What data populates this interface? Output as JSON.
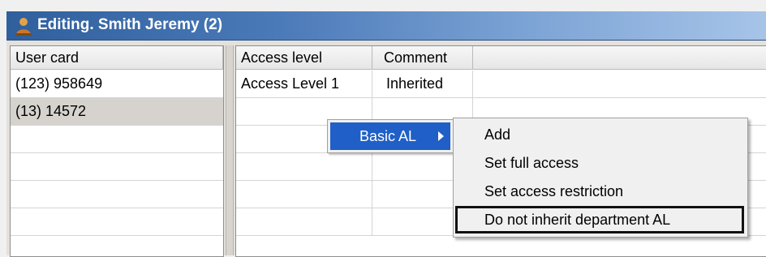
{
  "window": {
    "title": "Editing. Smith Jeremy (2)",
    "title_icon": "user-icon"
  },
  "left_table": {
    "header": "User card",
    "rows": [
      "(123) 958649",
      "(13) 14572",
      "",
      "",
      "",
      ""
    ],
    "selected_row": 1
  },
  "right_table": {
    "headers": [
      "Access level",
      "Comment",
      ""
    ],
    "rows": [
      [
        "Access Level 1",
        "Inherited",
        ""
      ],
      [
        "",
        "",
        ""
      ],
      [
        "",
        "",
        ""
      ],
      [
        "",
        "",
        ""
      ],
      [
        "",
        "",
        ""
      ],
      [
        "",
        "",
        ""
      ]
    ]
  },
  "context_menu": {
    "item_label": "Basic AL",
    "item_icon": "submenu-arrow-icon",
    "submenu": [
      "Add",
      "Set full access",
      "Set access restriction",
      "Do not inherit department AL"
    ],
    "highlighted_index": 3
  },
  "colors": {
    "titlebar_start": "#2f5f9c",
    "menu_highlight": "#1f5fc7"
  }
}
